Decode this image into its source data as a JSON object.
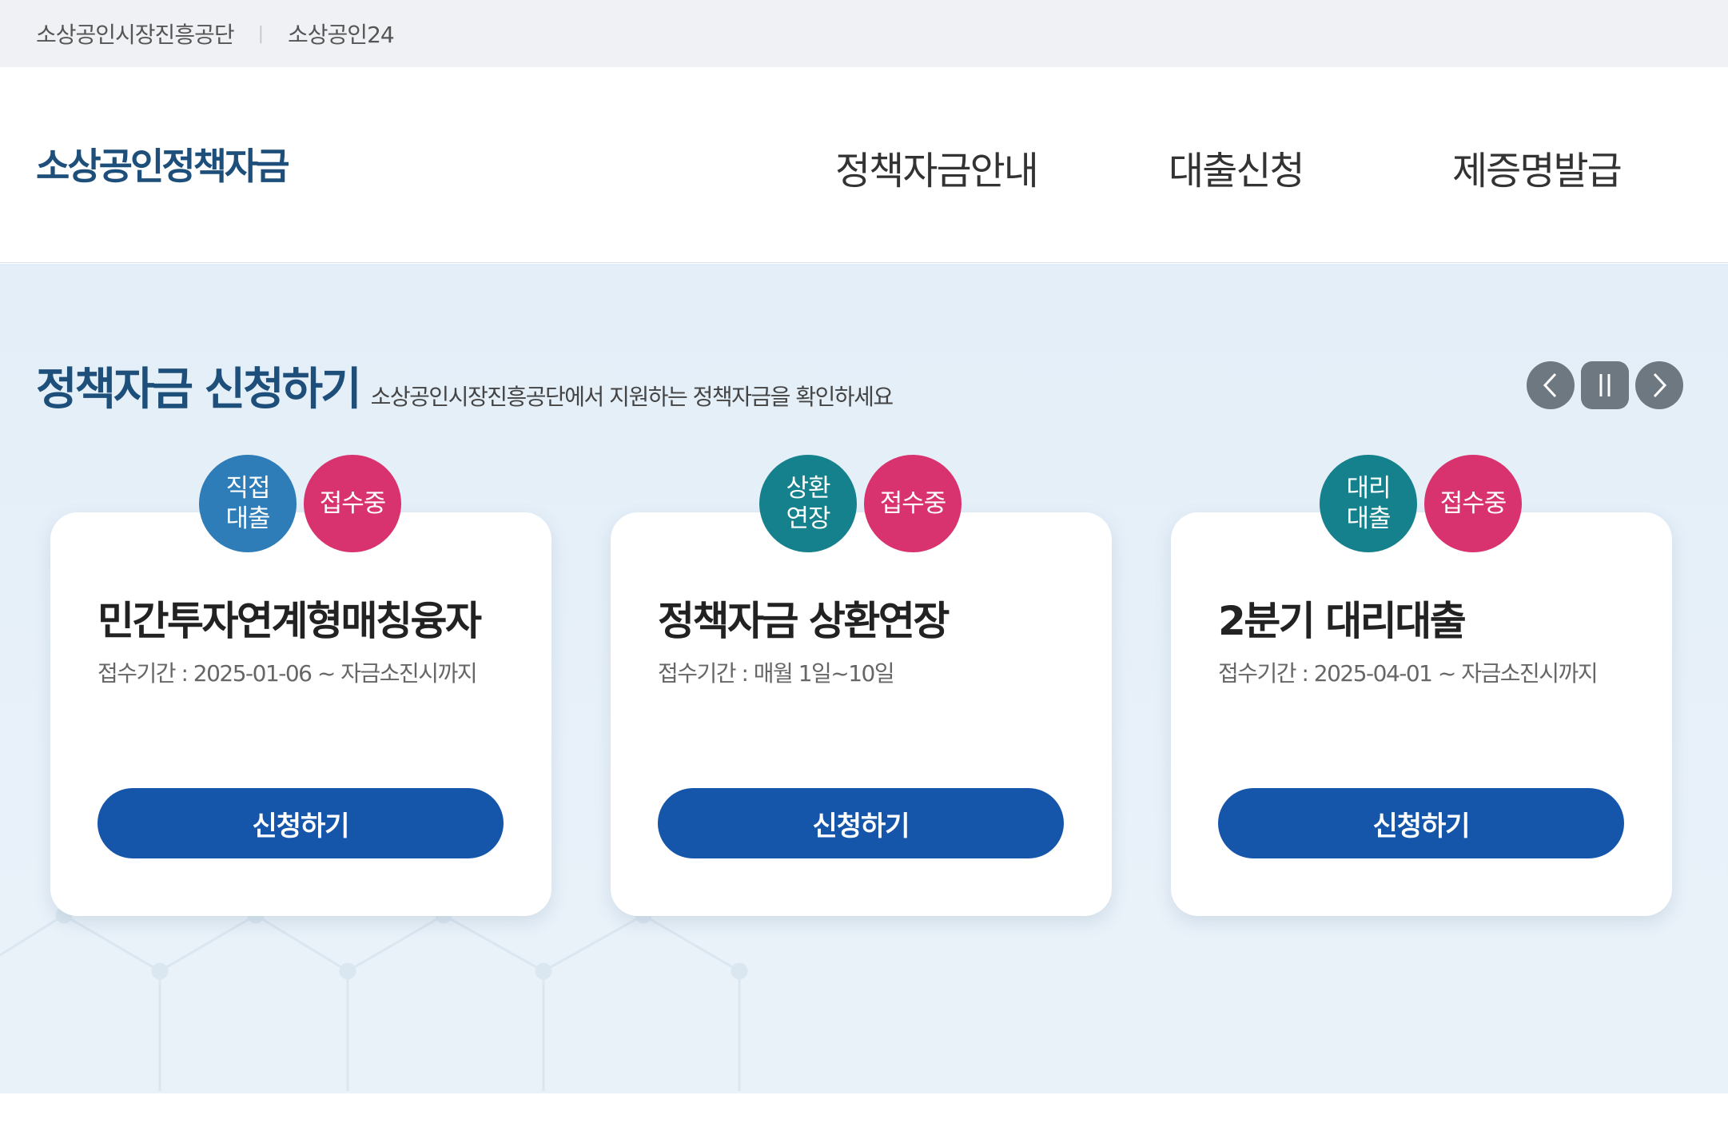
{
  "utility": {
    "links": [
      "소상공인시장진흥공단",
      "소상공인24"
    ],
    "separator": "|"
  },
  "header": {
    "logo": "소상공인정책자금",
    "nav": [
      "정책자금안내",
      "대출신청",
      "제증명발급"
    ]
  },
  "section": {
    "title": "정책자금 신청하기",
    "subtitle": "소상공인시장진흥공단에서 지원하는 정책자금을 확인하세요"
  },
  "slider": {
    "prev_icon": "chevron-left-icon",
    "pause_icon": "pause-icon",
    "next_icon": "chevron-right-icon"
  },
  "cards": [
    {
      "type_badge": "직접\n대출",
      "type_color": "#2e7cb8",
      "status_badge": "접수중",
      "title": "민간투자연계형매칭융자",
      "period": "접수기간 : 2025-01-06 ~ 자금소진시까지",
      "button": "신청하기"
    },
    {
      "type_badge": "상환\n연장",
      "type_color": "#15818d",
      "status_badge": "접수중",
      "title": "정책자금 상환연장",
      "period": "접수기간 : 매월 1일~10일",
      "button": "신청하기"
    },
    {
      "type_badge": "대리\n대출",
      "type_color": "#15818d",
      "status_badge": "접수중",
      "title": "2분기 대리대출",
      "period": "접수기간 : 2025-04-01 ~ 자금소진시까지",
      "button": "신청하기"
    }
  ],
  "colors": {
    "brand": "#1d4f7a",
    "status": "#d9336f",
    "button": "#1556ab",
    "control": "#6e7881"
  }
}
